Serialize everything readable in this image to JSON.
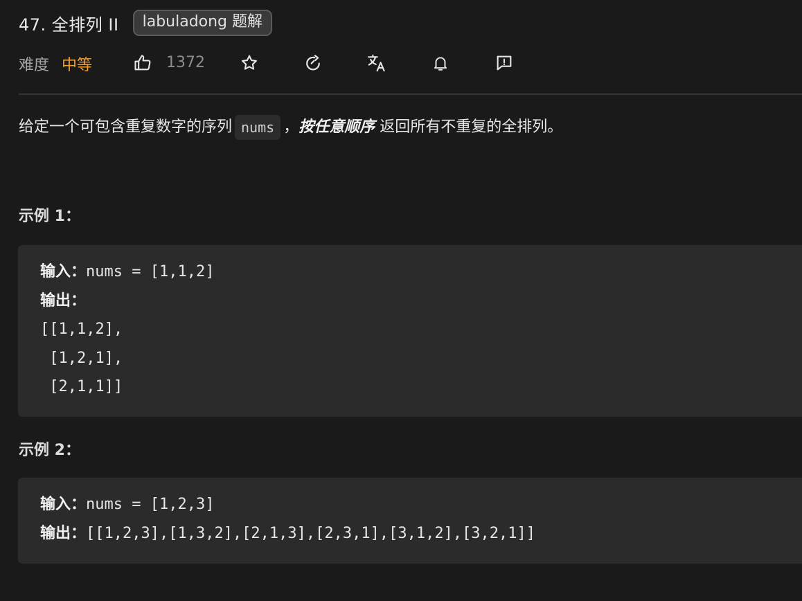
{
  "header": {
    "title": "47. 全排列 II",
    "tag_badge": "labuladong 题解"
  },
  "meta": {
    "difficulty_label": "难度",
    "difficulty_value": "中等",
    "difficulty_color": "#f0a030",
    "like_count": "1372",
    "icons": [
      "thumbs-up-icon",
      "star-icon",
      "refresh-icon",
      "translate-icon",
      "bell-icon",
      "feedback-icon"
    ]
  },
  "description": {
    "prefix": "给定一个可包含重复数字的序列",
    "code": "nums",
    "comma": "，",
    "emphasis": "按任意顺序",
    "suffix": "返回所有不重复的全排列。"
  },
  "examples": [
    {
      "heading": "示例 1：",
      "input_label": "输入：",
      "input_value": "nums = [1,1,2]",
      "output_label": "输出：",
      "output_lines": [
        "[[1,1,2],",
        " [1,2,1],",
        " [2,1,1]]"
      ]
    },
    {
      "heading": "示例 2：",
      "input_label": "输入：",
      "input_value": "nums = [1,2,3]",
      "output_label": "输出：",
      "output_value": "[[1,2,3],[1,3,2],[2,1,3],[2,3,1],[3,1,2],[3,2,1]]"
    }
  ]
}
